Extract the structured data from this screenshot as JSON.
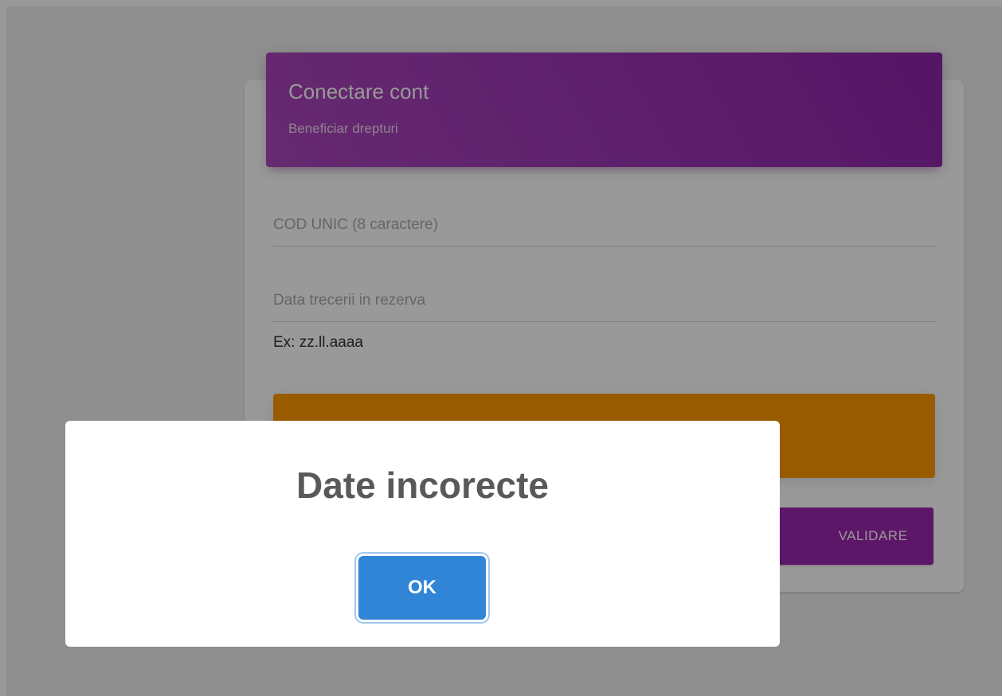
{
  "card": {
    "title": "Conectare cont",
    "subtitle": "Beneficiar drepturi"
  },
  "form": {
    "code_field": {
      "placeholder": "COD UNIC (8 caractere)",
      "value": ""
    },
    "date_field": {
      "placeholder": "Data trecerii in rezerva",
      "value": "",
      "hint": "Ex: zz.ll.aaaa"
    },
    "validate_button_label": "VALIDARE"
  },
  "dialog": {
    "title": "Date incorecte",
    "ok_label": "OK"
  },
  "colors": {
    "header_accent": "#9c27b0",
    "alert_warning": "#ff9800",
    "dialog_confirm": "#3085d6"
  }
}
